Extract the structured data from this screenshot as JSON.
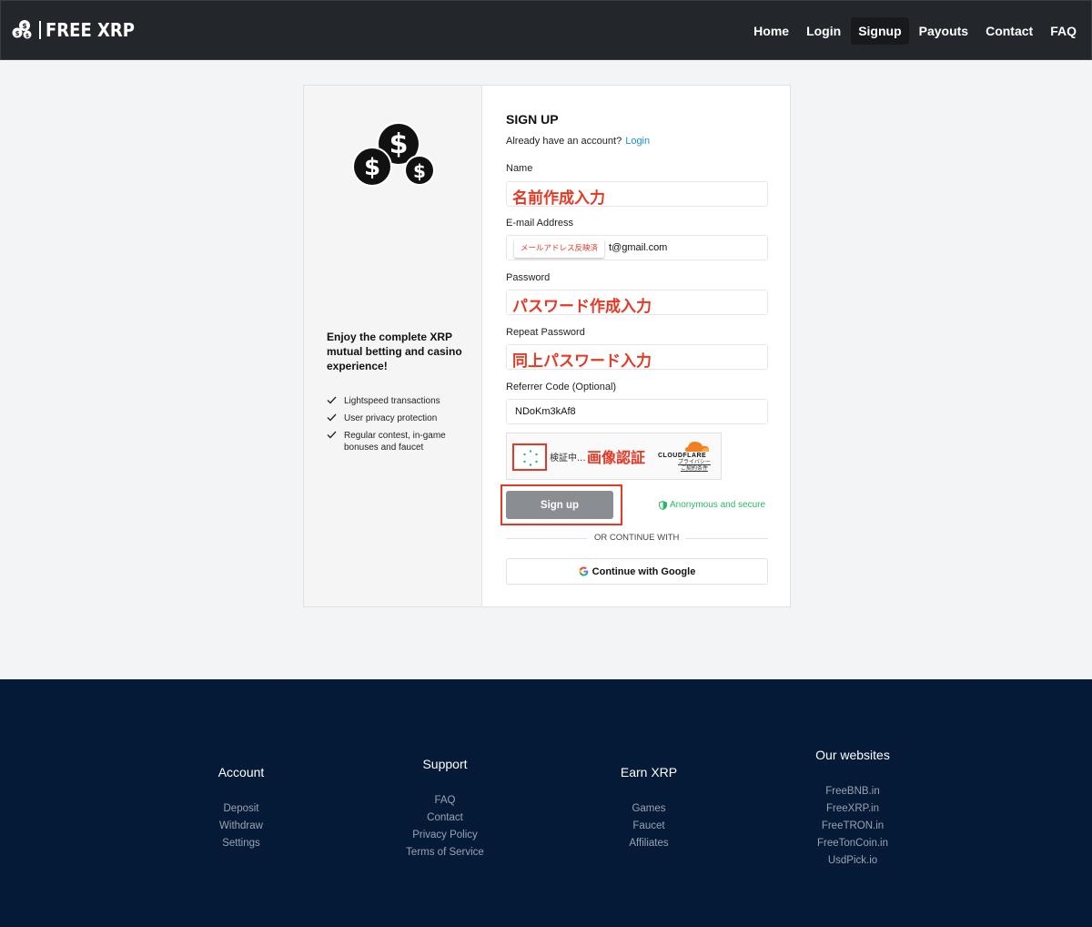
{
  "header": {
    "brand": "FREE XRP",
    "nav": [
      {
        "label": "Home",
        "active": false
      },
      {
        "label": "Login",
        "active": false
      },
      {
        "label": "Signup",
        "active": true
      },
      {
        "label": "Payouts",
        "active": false
      },
      {
        "label": "Contact",
        "active": false
      },
      {
        "label": "FAQ",
        "active": false
      }
    ]
  },
  "left_panel": {
    "promo": "Enjoy the complete XRP mutual betting and casino experience!",
    "features": [
      "Lightspeed transactions",
      "User privacy protection",
      "Regular contest, in-game bonuses and faucet"
    ]
  },
  "form": {
    "title": "SIGN UP",
    "have_account": "Already have an account?",
    "login_link": "Login",
    "name_label": "Name",
    "name_annotation": "名前作成入力",
    "email_label": "E-mail Address",
    "email_annotation": "メールアドレス反映済",
    "email_suffix": "t@gmail.com",
    "password_label": "Password",
    "password_annotation": "パスワード作成入力",
    "repeat_label": "Repeat Password",
    "repeat_annotation": "同上パスワード入力",
    "referrer_label": "Referrer Code (Optional)",
    "referrer_value": "NDoKm3kAf8",
    "captcha_checking": "検証中...",
    "captcha_annotation": "画像認証",
    "cf_brand": "CLOUDFLARE",
    "cf_privacy": "プライバシー",
    "cf_terms": "ご契約条件",
    "signup_label": "Sign up",
    "secure_text": "Anonymous and secure",
    "or_text": "OR CONTINUE WITH",
    "google_label": "Continue with Google"
  },
  "footer": {
    "columns": [
      {
        "title": "Account",
        "links": [
          "Deposit",
          "Withdraw",
          "Settings"
        ]
      },
      {
        "title": "Support",
        "links": [
          "FAQ",
          "Contact",
          "Privacy Policy",
          "Terms of Service"
        ]
      },
      {
        "title": "Earn XRP",
        "links": [
          "Games",
          "Faucet",
          "Affiliates"
        ]
      },
      {
        "title": "Our websites",
        "links": [
          "FreeBNB.in",
          "FreeXRP.in",
          "FreeTRON.in",
          "FreeTonCoin.in",
          "UsdPick.io"
        ]
      }
    ]
  },
  "colors": {
    "header_bg": "#23262b",
    "footer_bg": "#051a36",
    "annotation_red": "#e53925",
    "secure_green": "#2ab86b",
    "link_blue": "#1f8fd6"
  }
}
